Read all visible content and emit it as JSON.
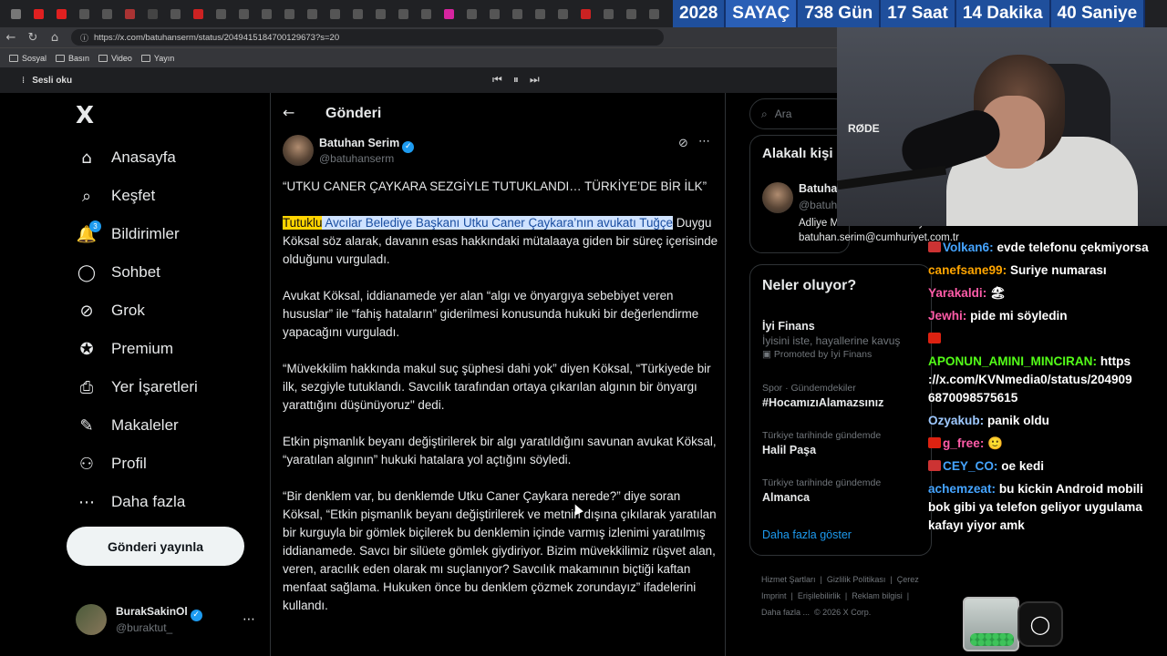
{
  "browser": {
    "tabs": [
      {
        "icon": "window-icon",
        "color": "#777"
      },
      {
        "icon": "youtube-icon",
        "color": "#e02020"
      },
      {
        "icon": "youtube-icon",
        "color": "#e02020"
      },
      {
        "icon": "x-icon",
        "color": "#555"
      },
      {
        "icon": "x-icon",
        "color": "#555"
      },
      {
        "icon": "site-icon",
        "color": "#a33"
      },
      {
        "icon": "b-icon",
        "color": "#444"
      },
      {
        "icon": "x-icon",
        "color": "#555"
      },
      {
        "icon": "news-icon",
        "color": "#c22"
      },
      {
        "icon": "x-icon",
        "color": "#555"
      },
      {
        "icon": "x-icon",
        "color": "#555"
      },
      {
        "icon": "x-icon",
        "color": "#555"
      },
      {
        "icon": "x-icon",
        "color": "#555"
      },
      {
        "icon": "x-icon",
        "color": "#555"
      },
      {
        "icon": "x-icon",
        "color": "#555"
      },
      {
        "icon": "x-icon",
        "color": "#555"
      },
      {
        "icon": "x-icon",
        "color": "#555"
      },
      {
        "icon": "x-icon",
        "color": "#555"
      },
      {
        "icon": "x-icon",
        "color": "#555"
      },
      {
        "icon": "instagram-icon",
        "color": "#d6249f"
      },
      {
        "icon": "x-icon",
        "color": "#555"
      },
      {
        "icon": "x-icon",
        "color": "#555"
      },
      {
        "icon": "x-icon",
        "color": "#555"
      },
      {
        "icon": "x-icon",
        "color": "#555"
      },
      {
        "icon": "x-icon",
        "color": "#555"
      },
      {
        "icon": "news-icon",
        "color": "#c22"
      },
      {
        "icon": "x-icon",
        "color": "#555"
      },
      {
        "icon": "x-icon",
        "color": "#555"
      },
      {
        "icon": "x-icon",
        "color": "#555"
      }
    ],
    "url": "https://x.com/batuhanserm/status/2049415184700129673?s=20",
    "bookmarks": [
      "Sosyal",
      "Basın",
      "Video",
      "Yayın"
    ],
    "read_aloud": "Sesli oku"
  },
  "counter": {
    "year": "2028",
    "label": "SAYAÇ",
    "days": "738 Gün",
    "hours": "17 Saat",
    "minutes": "14 Dakika",
    "seconds": "40 Saniye",
    "color": "#1f4f9c"
  },
  "nav": {
    "logo": "X",
    "items": [
      {
        "label": "Anasayfa",
        "icon": "home-icon",
        "glyph": "⌂"
      },
      {
        "label": "Keşfet",
        "icon": "search-icon",
        "glyph": "⌕"
      },
      {
        "label": "Bildirimler",
        "icon": "bell-icon",
        "glyph": "🔔",
        "badge": "3"
      },
      {
        "label": "Sohbet",
        "icon": "chat-icon",
        "glyph": "◯"
      },
      {
        "label": "Grok",
        "icon": "grok-icon",
        "glyph": "⊘"
      },
      {
        "label": "Premium",
        "icon": "premium-icon",
        "glyph": "✪"
      },
      {
        "label": "Yer İşaretleri",
        "icon": "bookmark-icon",
        "glyph": "⎙"
      },
      {
        "label": "Makaleler",
        "icon": "article-icon",
        "glyph": "✎"
      },
      {
        "label": "Profil",
        "icon": "profile-icon",
        "glyph": "⚇"
      },
      {
        "label": "Daha fazla",
        "icon": "more-icon",
        "glyph": "⋯"
      }
    ],
    "post_button": "Gönderi yayınla",
    "account": {
      "name": "BurakSakinOl",
      "handle": "@buraktut_"
    }
  },
  "main": {
    "title": "Gönderi",
    "author": {
      "name": "Batuhan Serim",
      "handle": "@batuhanserm"
    },
    "paragraphs": [
      "“UTKU CANER ÇAYKARA SEZGİYLE TUTUKLANDI… TÜRKİYE’DE BİR İLK”",
      "Duygu Köksal söz alarak, davanın esas hakkındaki mütalaaya giden bir süreç içerisinde olduğunu vurguladı.",
      "Avukat Köksal, iddianamede yer alan “algı ve önyargıya sebebiyet veren hususlar” ile “fahiş hataların” giderilmesi konusunda hukuki bir değerlendirme yapacağını vurguladı.",
      "“Müvekkilim hakkında makul suç şüphesi dahi yok” diyen Köksal, “Türkiyede bir ilk, sezgiyle tutuklandı. Savcılık tarafından ortaya çıkarılan algının bir önyargı yarattığını düşünüyoruz\" dedi.",
      "Etkin pişmanlık beyanı değiştirilerek bir algı yaratıldığını savunan avukat Köksal, “yaratılan algının” hukuki hatalara yol açtığını söyledi.",
      "“Bir denklem var, bu denklemde Utku Caner Çaykara nerede?” diye soran Köksal, “Etkin pişmanlık beyanı değiştirilerek ve metnin dışına çıkılarak yaratılan bir kurguyla bir gömlek biçilerek bu denklemin içinde varmış izlenimi yaratılmış iddianamede. Savcı bir silüete gömlek giydiriyor. Bizim müvekkilimiz rüşvet alan, veren, aracılık eden olarak mı suçlanıyor? Savcılık makamının biçtiği kaftan menfaat sağlama. Hukuken önce bu denklem çözmek zorundayız” ifadelerini kullandı."
    ],
    "highlight_word": "Tutuklu",
    "highlight_rest": " Avcılar Belediye Başkanı Utku Caner Çaykara’nın avukatı Tuğçe",
    "highlight_color": "#ffd400"
  },
  "right": {
    "search_placeholder": "Ara",
    "related_title": "Alakalı kişi",
    "related": {
      "name": "Batuhan Serim",
      "handle": "@batuh",
      "bio": "Adliye Muhabiri / Cumhuriyet Gazetesi",
      "email": "batuhan.serim@cumhuriyet.com.tr"
    },
    "trends_title": "Neler oluyor?",
    "trends": [
      {
        "context": "",
        "name": "İyi Finans",
        "sub": "İyisini iste, hayallerine kavuş",
        "promo": "Promoted by İyi Finans"
      },
      {
        "context": "Spor · Gündemdekiler",
        "name": "#HocamızıAlamazsınız",
        "sub": "",
        "promo": ""
      },
      {
        "context": "Türkiye tarihinde gündemde",
        "name": "Halil Paşa",
        "sub": "",
        "promo": ""
      },
      {
        "context": "Türkiye tarihinde gündemde",
        "name": "Almanca",
        "sub": "",
        "promo": ""
      }
    ],
    "show_more": "Daha fazla göster",
    "footer": [
      "Hizmet Şartları",
      "|",
      "Gizlilik Politikası",
      "|",
      "Çerez",
      "Imprint",
      "|",
      "Erişilebilirlik",
      "|",
      "Reklam bilgisi",
      "|",
      "Daha fazla ...",
      "© 2026 X Corp."
    ]
  },
  "webcam": {
    "mic_brand": "RØDE"
  },
  "chat": [
    {
      "user": "Volkan6",
      "color": "#45a4ff",
      "text": "evde telefonu çekmiyorsa",
      "badge": "#c33"
    },
    {
      "user": "canefsane99",
      "color": "#ffa500",
      "text": "Suriye numarası",
      "badge": ""
    },
    {
      "user": "Yarakaldi",
      "color": "#ff5ca8",
      "text": "🏖",
      "badge": ""
    },
    {
      "user": "Jewhi",
      "color": "#ff5ca8",
      "text": "pide mi söyledin",
      "badge": ""
    },
    {
      "user": "",
      "color": "#ff5ca8",
      "text": "",
      "badge": "#d21"
    },
    {
      "user": "APONUN_AMINI_MINCIRAN",
      "color": "#53fc18",
      "text": "https ://x.com/KVNmedia0/status/204909 6870098575615",
      "badge": ""
    },
    {
      "user": "Ozyakub",
      "color": "#9ec9ff",
      "text": "panik oldu",
      "badge": ""
    },
    {
      "user": "g_free",
      "color": "#ff5ca8",
      "text": "🙂",
      "badge": "#d21"
    },
    {
      "user": "CEY_CO",
      "color": "#45a4ff",
      "text": "oe kedi",
      "badge": "#c33"
    },
    {
      "user": "achemzeat",
      "color": "#45a4ff",
      "text": "bu kickin Android mobili bok gibi ya telefon geliyor uygulama kafayı yiyor amk",
      "badge": ""
    }
  ]
}
